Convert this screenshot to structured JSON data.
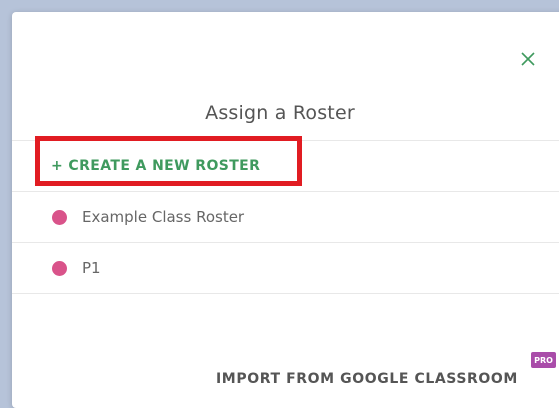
{
  "modal": {
    "title": "Assign a Roster",
    "close_icon": "close-icon",
    "create_label": "+ CREATE A NEW ROSTER",
    "rosters": [
      {
        "label": "Example Class Roster",
        "color": "#d9538a"
      },
      {
        "label": "P1",
        "color": "#d9538a"
      }
    ],
    "import_label": "IMPORT FROM GOOGLE CLASSROOM",
    "pro_badge": "PRO"
  },
  "colors": {
    "accent_green": "#3f9a5e",
    "highlight_red": "#e11c22",
    "pro_purple": "#a94ca9",
    "backdrop": "#b6c3d9"
  }
}
